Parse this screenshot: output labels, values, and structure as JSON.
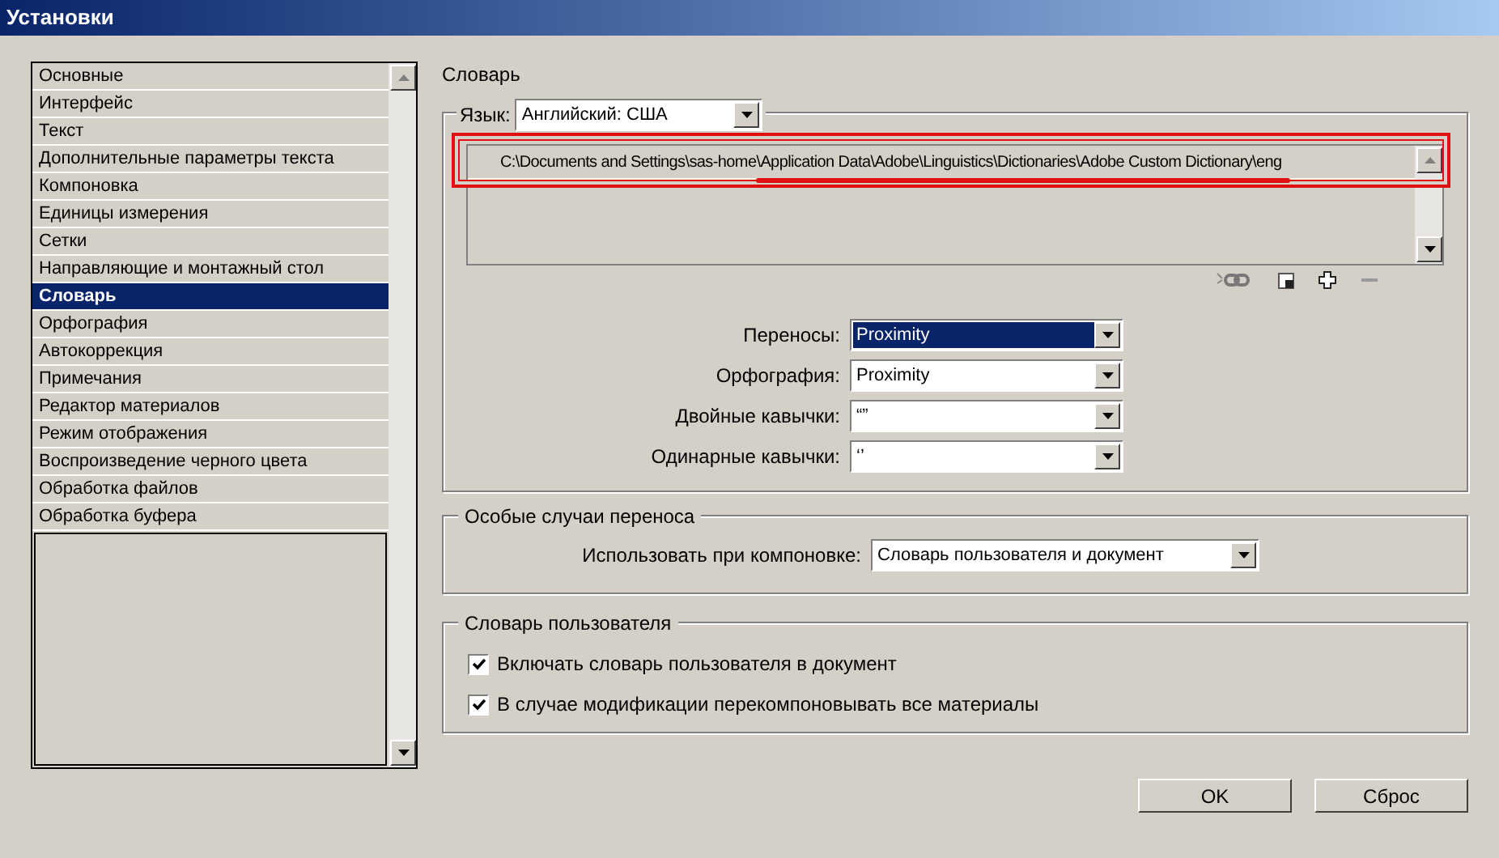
{
  "window": {
    "title": "Установки"
  },
  "sidebar": {
    "items": [
      {
        "label": "Основные",
        "selected": false
      },
      {
        "label": "Интерфейс",
        "selected": false
      },
      {
        "label": "Текст",
        "selected": false
      },
      {
        "label": "Дополнительные параметры текста",
        "selected": false
      },
      {
        "label": "Компоновка",
        "selected": false
      },
      {
        "label": "Единицы измерения",
        "selected": false
      },
      {
        "label": "Сетки",
        "selected": false
      },
      {
        "label": "Направляющие и монтажный стол",
        "selected": false
      },
      {
        "label": "Словарь",
        "selected": true
      },
      {
        "label": "Орфография",
        "selected": false
      },
      {
        "label": "Автокоррекция",
        "selected": false
      },
      {
        "label": "Примечания",
        "selected": false
      },
      {
        "label": "Редактор материалов",
        "selected": false
      },
      {
        "label": "Режим отображения",
        "selected": false
      },
      {
        "label": "Воспроизведение черного цвета",
        "selected": false
      },
      {
        "label": "Обработка файлов",
        "selected": false
      },
      {
        "label": "Обработка буфера",
        "selected": false
      }
    ]
  },
  "section_title": "Словарь",
  "language": {
    "label": "Язык:",
    "value": "Английский: США"
  },
  "dictionary_paths": [
    {
      "path": "C:\\Documents and Settings\\sas-home\\Application Data\\Adobe\\Linguistics\\Dictionaries\\Adobe Custom Dictionary\\eng",
      "highlighted": true
    }
  ],
  "dropdowns": [
    {
      "label": "Переносы:",
      "value": "Proximity",
      "focused": true
    },
    {
      "label": "Орфография:",
      "value": "Proximity",
      "focused": false
    },
    {
      "label": "Двойные кавычки:",
      "value": "“”",
      "focused": false
    },
    {
      "label": "Одинарные кавычки:",
      "value": "‘’",
      "focused": false
    }
  ],
  "hyphenation": {
    "title": "Особые случаи переноса",
    "label": "Использовать при компоновке:",
    "value": "Словарь пользователя и документ"
  },
  "user_dictionary": {
    "title": "Словарь пользователя",
    "options": [
      {
        "label": "Включать словарь пользователя в документ",
        "checked": true
      },
      {
        "label": "В случае модификации перекомпоновывать все материалы",
        "checked": true
      }
    ]
  },
  "buttons": [
    "OK",
    "Сброс"
  ]
}
